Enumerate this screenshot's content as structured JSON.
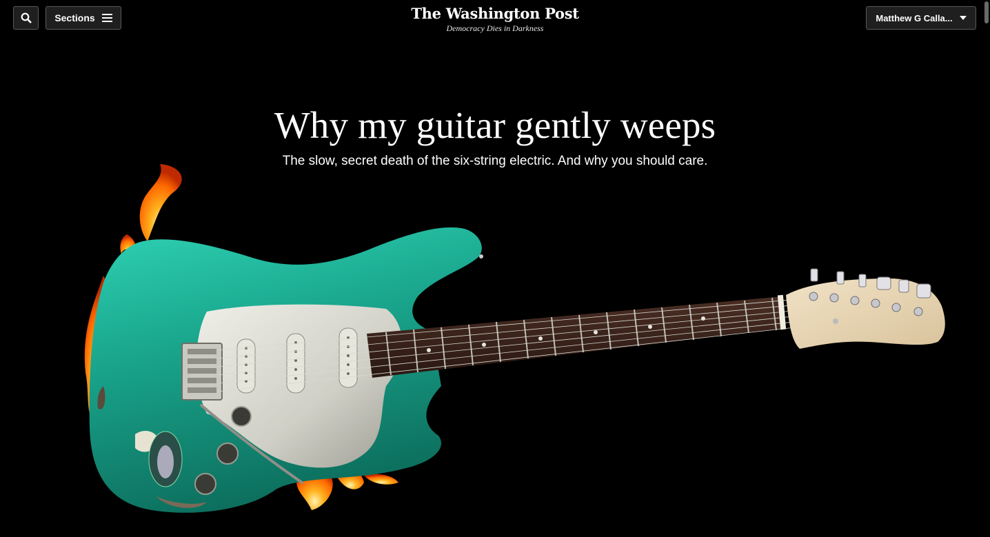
{
  "header": {
    "sections_label": "Sections",
    "logo": "The Washington Post",
    "tagline": "Democracy Dies in Darkness",
    "user_label": "Matthew G Calla..."
  },
  "article": {
    "headline": "Why my guitar gently weeps",
    "dek": "The slow, secret death of the six-string electric. And why you should care."
  },
  "icons": {
    "search": "search-icon",
    "sections": "hamburger-icon",
    "user_menu": "caret-down-icon",
    "hero": "burning-guitar-image"
  },
  "colors": {
    "background": "#000000",
    "button_bg": "#1f1f1f",
    "guitar_body": "#1fb39a",
    "flame": "#ff7a12"
  }
}
